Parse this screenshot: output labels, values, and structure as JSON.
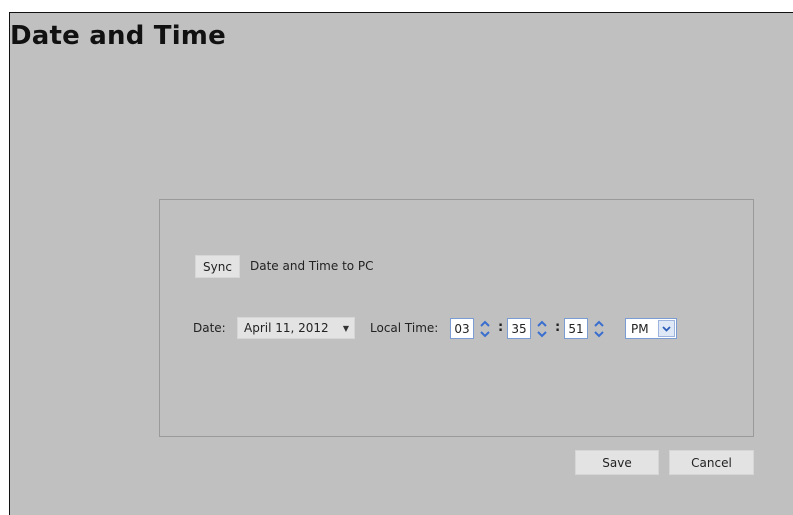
{
  "page": {
    "title": "Date and Time"
  },
  "sync": {
    "button_label": "Sync",
    "label": "Date and Time to PC"
  },
  "date": {
    "label": "Date:",
    "value": "April 11, 2012"
  },
  "time": {
    "label": "Local Time:",
    "hours": "03",
    "minutes": "35",
    "seconds": "51",
    "separator": ":",
    "ampm": "PM"
  },
  "actions": {
    "save_label": "Save",
    "cancel_label": "Cancel"
  },
  "colors": {
    "background": "#c0c0c0",
    "button": "#e3e3e3",
    "spinner_accent": "#3a6ecf"
  },
  "icons": {
    "date_dropdown": "caret-down-icon",
    "spinner": "up-down-arrows-icon",
    "ampm_dropdown": "chevron-down-icon"
  }
}
